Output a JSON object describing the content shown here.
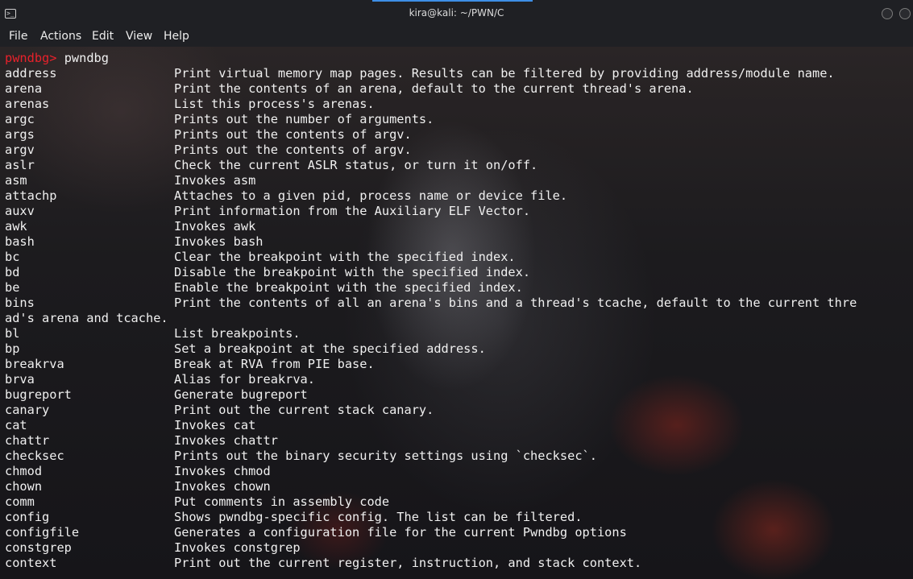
{
  "window": {
    "title": "kira@kali: ~/PWN/C",
    "app_icon": "terminal-icon",
    "buttons": [
      "minimize-button",
      "close-button"
    ]
  },
  "menubar": {
    "items": [
      "File",
      "Actions",
      "Edit",
      "View",
      "Help"
    ]
  },
  "colors": {
    "prompt": "#e8212b",
    "text": "#f0f0f0",
    "accent": "#3d8ee6"
  },
  "terminal": {
    "prompt_text": "pwndbg> ",
    "prompt_command": "pwndbg",
    "rows": [
      {
        "cmd": "address",
        "desc": "Print virtual memory map pages. Results can be filtered by providing address/module name."
      },
      {
        "cmd": "arena",
        "desc": "Print the contents of an arena, default to the current thread's arena."
      },
      {
        "cmd": "arenas",
        "desc": "List this process's arenas."
      },
      {
        "cmd": "argc",
        "desc": "Prints out the number of arguments."
      },
      {
        "cmd": "args",
        "desc": "Prints out the contents of argv."
      },
      {
        "cmd": "argv",
        "desc": "Prints out the contents of argv."
      },
      {
        "cmd": "aslr",
        "desc": "Check the current ASLR status, or turn it on/off."
      },
      {
        "cmd": "asm",
        "desc": "Invokes asm"
      },
      {
        "cmd": "attachp",
        "desc": "Attaches to a given pid, process name or device file."
      },
      {
        "cmd": "auxv",
        "desc": "Print information from the Auxiliary ELF Vector."
      },
      {
        "cmd": "awk",
        "desc": "Invokes awk"
      },
      {
        "cmd": "bash",
        "desc": "Invokes bash"
      },
      {
        "cmd": "bc",
        "desc": "Clear the breakpoint with the specified index."
      },
      {
        "cmd": "bd",
        "desc": "Disable the breakpoint with the specified index."
      },
      {
        "cmd": "be",
        "desc": "Enable the breakpoint with the specified index."
      },
      {
        "cmd": "bins",
        "desc": "Print the contents of all an arena's bins and a thread's tcache, default to the current thre"
      },
      {
        "cmd": "",
        "desc": "",
        "wrap": "ad's arena and tcache."
      },
      {
        "cmd": "bl",
        "desc": "List breakpoints."
      },
      {
        "cmd": "bp",
        "desc": "Set a breakpoint at the specified address."
      },
      {
        "cmd": "breakrva",
        "desc": "Break at RVA from PIE base."
      },
      {
        "cmd": "brva",
        "desc": "Alias for breakrva."
      },
      {
        "cmd": "bugreport",
        "desc": "Generate bugreport"
      },
      {
        "cmd": "canary",
        "desc": "Print out the current stack canary."
      },
      {
        "cmd": "cat",
        "desc": "Invokes cat"
      },
      {
        "cmd": "chattr",
        "desc": "Invokes chattr"
      },
      {
        "cmd": "checksec",
        "desc": "Prints out the binary security settings using `checksec`."
      },
      {
        "cmd": "chmod",
        "desc": "Invokes chmod"
      },
      {
        "cmd": "chown",
        "desc": "Invokes chown"
      },
      {
        "cmd": "comm",
        "desc": "Put comments in assembly code"
      },
      {
        "cmd": "config",
        "desc": "Shows pwndbg-specific config. The list can be filtered."
      },
      {
        "cmd": "configfile",
        "desc": "Generates a configuration file for the current Pwndbg options"
      },
      {
        "cmd": "constgrep",
        "desc": "Invokes constgrep"
      },
      {
        "cmd": "context",
        "desc": "Print out the current register, instruction, and stack context."
      }
    ]
  }
}
